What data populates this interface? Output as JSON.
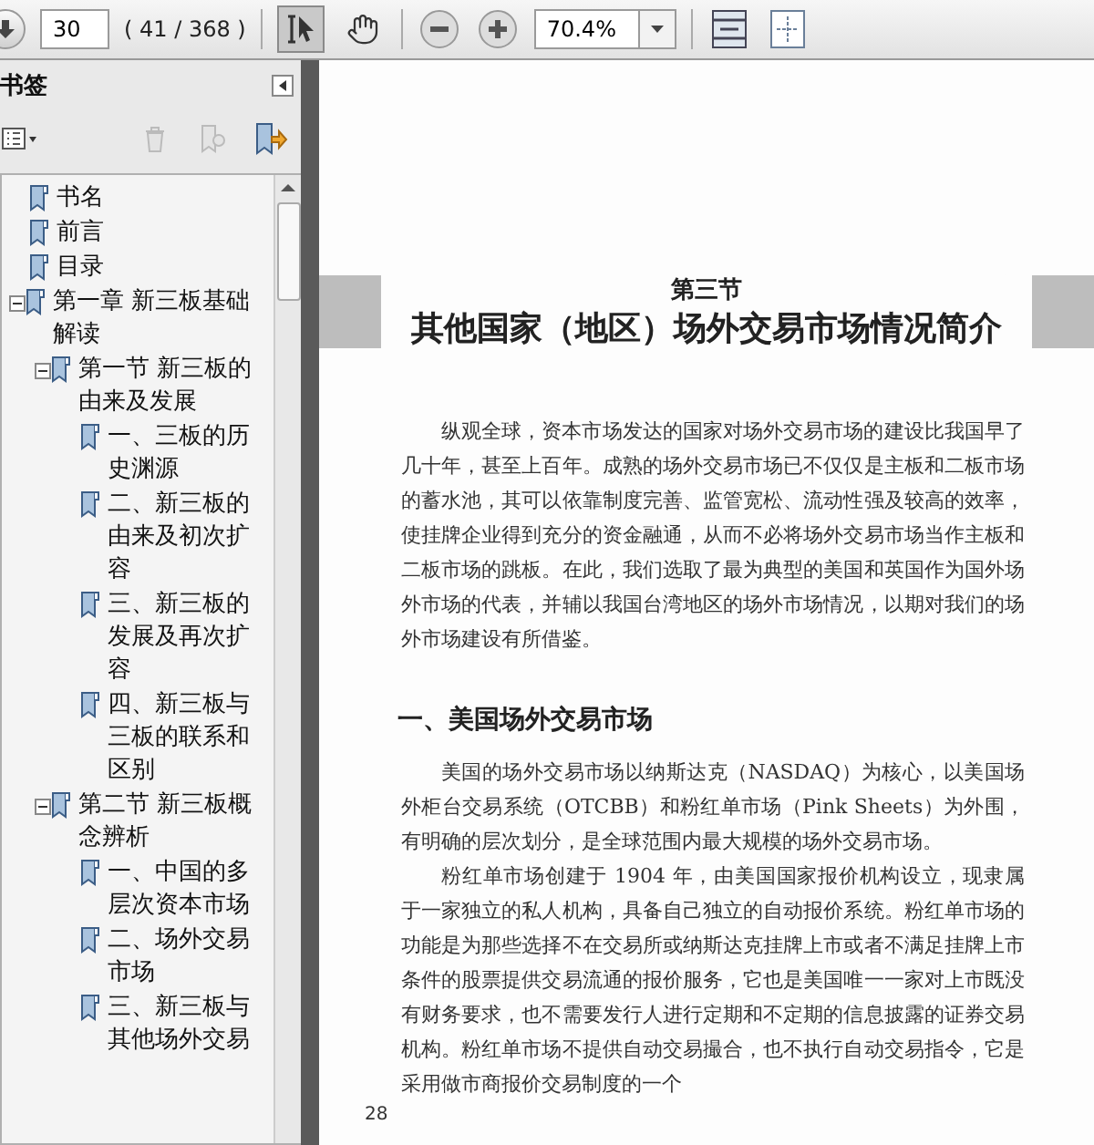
{
  "toolbar": {
    "page_input": "30",
    "page_count": "( 41 / 368 )",
    "tools": [
      {
        "kind": "select",
        "selected": true
      },
      {
        "kind": "hand",
        "selected": false
      }
    ],
    "zoom": "70.4%"
  },
  "bookmarks": {
    "title": "书签",
    "items": [
      {
        "label": "书名"
      },
      {
        "label": "前言"
      },
      {
        "label": "目录"
      },
      {
        "label": "第一章  新三板基础解读",
        "expanded": true,
        "children": [
          {
            "label": "第一节  新三板的由来及发展",
            "expanded": true,
            "children": [
              {
                "label": "一、三板的历史渊源"
              },
              {
                "label": "二、新三板的由来及初次扩容"
              },
              {
                "label": "三、新三板的发展及再次扩容"
              },
              {
                "label": "四、新三板与三板的联系和区别"
              }
            ]
          },
          {
            "label": "第二节  新三板概念辨析",
            "expanded": true,
            "children": [
              {
                "label": "一、中国的多层次资本市场"
              },
              {
                "label": "二、场外交易市场"
              },
              {
                "label": "三、新三板与其他场外交易"
              }
            ]
          }
        ]
      }
    ]
  },
  "document": {
    "section_label": "第三节",
    "section_title": "其他国家（地区）场外交易市场情况简介",
    "intro": [
      "纵观全球，资本市场发达的国家对场外交易市场的建设比我国早了几十年，甚至上百年。成熟的场外交易市场已不仅仅是主板和二板市场的蓄水池，其可以依靠制度完善、监管宽松、流动性强及较高的效率，使挂牌企业得到充分的资金融通，从而不必将场外交易市场当作主板和二板市场的跳板。在此，我们选取了最为典型的美国和英国作为国外场外市场的代表，并辅以我国台湾地区的场外市场情况，以期对我们的场外市场建设有所借鉴。"
    ],
    "heading": "一、美国场外交易市场",
    "paragraphs": [
      "美国的场外交易市场以纳斯达克（NASDAQ）为核心，以美国场外柜台交易系统（OTCBB）和粉红单市场（Pink Sheets）为外围，有明确的层次划分，是全球范围内最大规模的场外交易市场。",
      "粉红单市场创建于 1904 年，由美国国家报价机构设立，现隶属于一家独立的私人机构，具备自己独立的自动报价系统。粉红单市场的功能是为那些选择不在交易所或纳斯达克挂牌上市或者不满足挂牌上市条件的股票提供交易流通的报价服务，它也是美国唯一一家对上市既没有财务要求，也不需要发行人进行定期和不定期的信息披露的证券交易机构。粉红单市场不提供自动交易撮合，也不执行自动交易指令，它是采用做市商报价交易制度的一个"
    ],
    "page_number": "28"
  }
}
